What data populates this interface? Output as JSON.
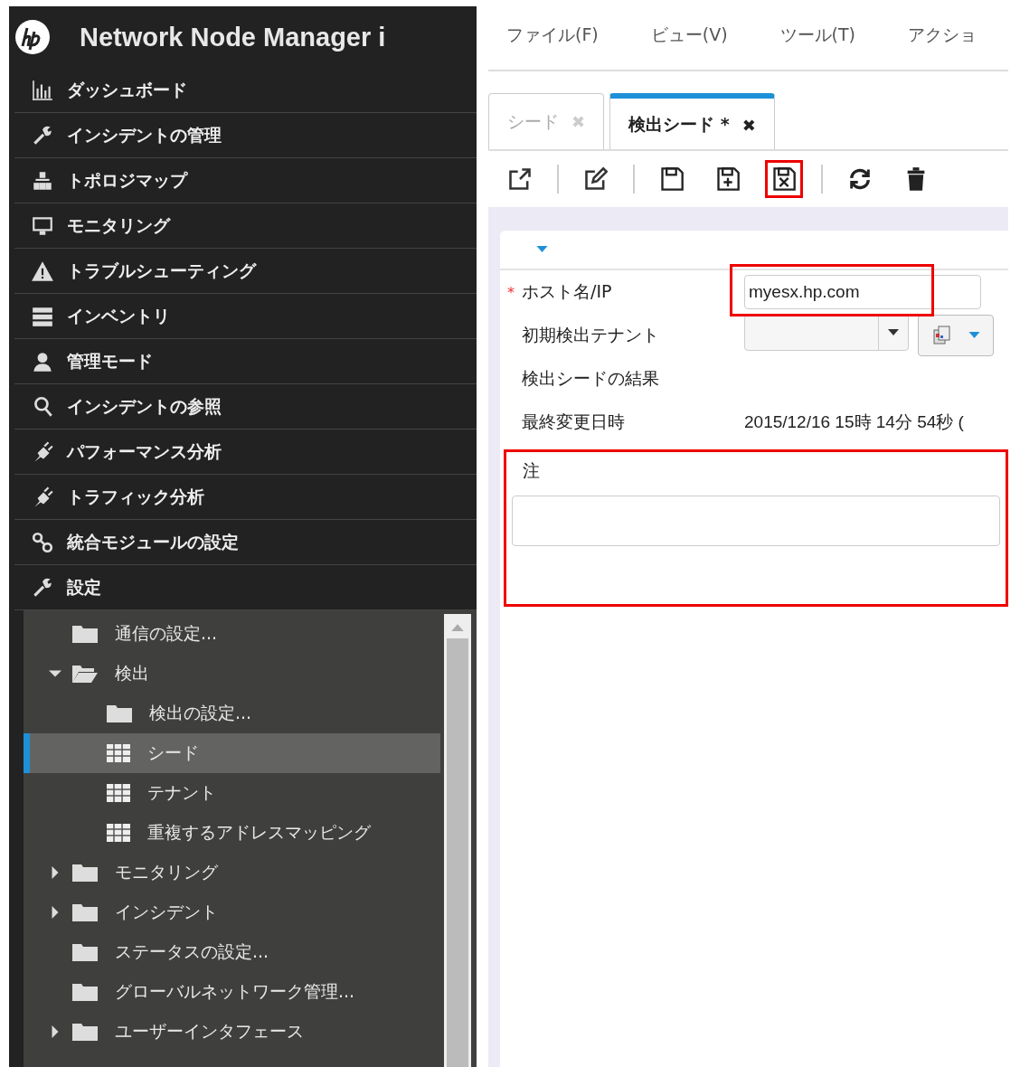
{
  "app": {
    "title": "Network Node Manager i"
  },
  "nav": [
    {
      "label": "ダッシュボード"
    },
    {
      "label": "インシデントの管理"
    },
    {
      "label": "トポロジマップ"
    },
    {
      "label": "モニタリング"
    },
    {
      "label": "トラブルシューティング"
    },
    {
      "label": "インベントリ"
    },
    {
      "label": "管理モード"
    },
    {
      "label": "インシデントの参照"
    },
    {
      "label": "パフォーマンス分析"
    },
    {
      "label": "トラフィック分析"
    },
    {
      "label": "統合モジュールの設定"
    },
    {
      "label": "設定"
    }
  ],
  "tree": [
    {
      "label": "通信の設定...",
      "kind": "folder",
      "selected": false
    },
    {
      "label": "検出",
      "kind": "folder",
      "selected": false,
      "expanded": true,
      "children": [
        {
          "label": "検出の設定...",
          "kind": "folder",
          "selected": false
        },
        {
          "label": "シード",
          "kind": "table",
          "selected": true
        },
        {
          "label": "テナント",
          "kind": "table",
          "selected": false
        },
        {
          "label": "重複するアドレスマッピング",
          "kind": "table",
          "selected": false
        }
      ]
    },
    {
      "label": "モニタリング",
      "kind": "folder",
      "selected": false,
      "expanded": false
    },
    {
      "label": "インシデント",
      "kind": "folder",
      "selected": false,
      "expanded": false
    },
    {
      "label": "ステータスの設定...",
      "kind": "folder",
      "selected": false
    },
    {
      "label": "グローバルネットワーク管理...",
      "kind": "folder",
      "selected": false
    },
    {
      "label": "ユーザーインタフェース",
      "kind": "folder",
      "selected": false,
      "expanded": false
    }
  ],
  "menu": [
    "ファイル(F)",
    "ビュー(V)",
    "ツール(T)",
    "アクショ"
  ],
  "tabs": [
    {
      "label": "シード",
      "close": "✖",
      "selected": false
    },
    {
      "label": "検出シード *",
      "close": "✖",
      "selected": true
    }
  ],
  "toolbar": [
    {
      "highlighted": false
    },
    {
      "highlighted": false
    },
    {
      "highlighted": false
    },
    {
      "highlighted": false
    },
    {
      "highlighted": true
    },
    {
      "highlighted": false
    },
    {
      "highlighted": false
    }
  ],
  "form": [
    {
      "kind": "input",
      "label": "ホスト名/IP",
      "required_mark": "*",
      "value": "myesx.hp.com",
      "highlighted": true
    },
    {
      "kind": "select",
      "label": "初期検出テナント"
    },
    {
      "kind": "text",
      "label": "検出シードの結果"
    },
    {
      "kind": "text",
      "label": "最終変更日時",
      "value": "2015/12/16 15時 14分 54秒 ("
    },
    {
      "kind": "textarea",
      "label": "注",
      "highlighted": true
    }
  ]
}
